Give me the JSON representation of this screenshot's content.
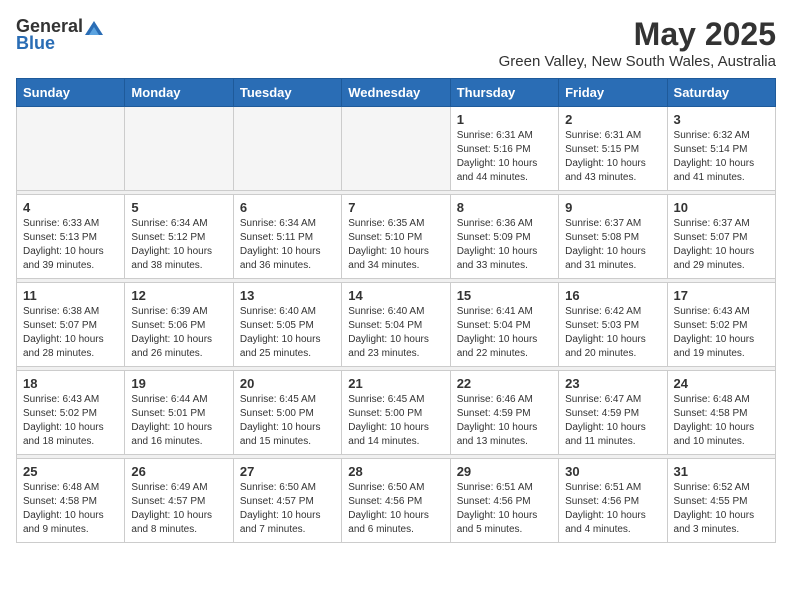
{
  "logo": {
    "general": "General",
    "blue": "Blue"
  },
  "title": {
    "month": "May 2025",
    "location": "Green Valley, New South Wales, Australia"
  },
  "weekdays": [
    "Sunday",
    "Monday",
    "Tuesday",
    "Wednesday",
    "Thursday",
    "Friday",
    "Saturday"
  ],
  "weeks": [
    [
      {
        "day": "",
        "info": ""
      },
      {
        "day": "",
        "info": ""
      },
      {
        "day": "",
        "info": ""
      },
      {
        "day": "",
        "info": ""
      },
      {
        "day": "1",
        "info": "Sunrise: 6:31 AM\nSunset: 5:16 PM\nDaylight: 10 hours\nand 44 minutes."
      },
      {
        "day": "2",
        "info": "Sunrise: 6:31 AM\nSunset: 5:15 PM\nDaylight: 10 hours\nand 43 minutes."
      },
      {
        "day": "3",
        "info": "Sunrise: 6:32 AM\nSunset: 5:14 PM\nDaylight: 10 hours\nand 41 minutes."
      }
    ],
    [
      {
        "day": "4",
        "info": "Sunrise: 6:33 AM\nSunset: 5:13 PM\nDaylight: 10 hours\nand 39 minutes."
      },
      {
        "day": "5",
        "info": "Sunrise: 6:34 AM\nSunset: 5:12 PM\nDaylight: 10 hours\nand 38 minutes."
      },
      {
        "day": "6",
        "info": "Sunrise: 6:34 AM\nSunset: 5:11 PM\nDaylight: 10 hours\nand 36 minutes."
      },
      {
        "day": "7",
        "info": "Sunrise: 6:35 AM\nSunset: 5:10 PM\nDaylight: 10 hours\nand 34 minutes."
      },
      {
        "day": "8",
        "info": "Sunrise: 6:36 AM\nSunset: 5:09 PM\nDaylight: 10 hours\nand 33 minutes."
      },
      {
        "day": "9",
        "info": "Sunrise: 6:37 AM\nSunset: 5:08 PM\nDaylight: 10 hours\nand 31 minutes."
      },
      {
        "day": "10",
        "info": "Sunrise: 6:37 AM\nSunset: 5:07 PM\nDaylight: 10 hours\nand 29 minutes."
      }
    ],
    [
      {
        "day": "11",
        "info": "Sunrise: 6:38 AM\nSunset: 5:07 PM\nDaylight: 10 hours\nand 28 minutes."
      },
      {
        "day": "12",
        "info": "Sunrise: 6:39 AM\nSunset: 5:06 PM\nDaylight: 10 hours\nand 26 minutes."
      },
      {
        "day": "13",
        "info": "Sunrise: 6:40 AM\nSunset: 5:05 PM\nDaylight: 10 hours\nand 25 minutes."
      },
      {
        "day": "14",
        "info": "Sunrise: 6:40 AM\nSunset: 5:04 PM\nDaylight: 10 hours\nand 23 minutes."
      },
      {
        "day": "15",
        "info": "Sunrise: 6:41 AM\nSunset: 5:04 PM\nDaylight: 10 hours\nand 22 minutes."
      },
      {
        "day": "16",
        "info": "Sunrise: 6:42 AM\nSunset: 5:03 PM\nDaylight: 10 hours\nand 20 minutes."
      },
      {
        "day": "17",
        "info": "Sunrise: 6:43 AM\nSunset: 5:02 PM\nDaylight: 10 hours\nand 19 minutes."
      }
    ],
    [
      {
        "day": "18",
        "info": "Sunrise: 6:43 AM\nSunset: 5:02 PM\nDaylight: 10 hours\nand 18 minutes."
      },
      {
        "day": "19",
        "info": "Sunrise: 6:44 AM\nSunset: 5:01 PM\nDaylight: 10 hours\nand 16 minutes."
      },
      {
        "day": "20",
        "info": "Sunrise: 6:45 AM\nSunset: 5:00 PM\nDaylight: 10 hours\nand 15 minutes."
      },
      {
        "day": "21",
        "info": "Sunrise: 6:45 AM\nSunset: 5:00 PM\nDaylight: 10 hours\nand 14 minutes."
      },
      {
        "day": "22",
        "info": "Sunrise: 6:46 AM\nSunset: 4:59 PM\nDaylight: 10 hours\nand 13 minutes."
      },
      {
        "day": "23",
        "info": "Sunrise: 6:47 AM\nSunset: 4:59 PM\nDaylight: 10 hours\nand 11 minutes."
      },
      {
        "day": "24",
        "info": "Sunrise: 6:48 AM\nSunset: 4:58 PM\nDaylight: 10 hours\nand 10 minutes."
      }
    ],
    [
      {
        "day": "25",
        "info": "Sunrise: 6:48 AM\nSunset: 4:58 PM\nDaylight: 10 hours\nand 9 minutes."
      },
      {
        "day": "26",
        "info": "Sunrise: 6:49 AM\nSunset: 4:57 PM\nDaylight: 10 hours\nand 8 minutes."
      },
      {
        "day": "27",
        "info": "Sunrise: 6:50 AM\nSunset: 4:57 PM\nDaylight: 10 hours\nand 7 minutes."
      },
      {
        "day": "28",
        "info": "Sunrise: 6:50 AM\nSunset: 4:56 PM\nDaylight: 10 hours\nand 6 minutes."
      },
      {
        "day": "29",
        "info": "Sunrise: 6:51 AM\nSunset: 4:56 PM\nDaylight: 10 hours\nand 5 minutes."
      },
      {
        "day": "30",
        "info": "Sunrise: 6:51 AM\nSunset: 4:56 PM\nDaylight: 10 hours\nand 4 minutes."
      },
      {
        "day": "31",
        "info": "Sunrise: 6:52 AM\nSunset: 4:55 PM\nDaylight: 10 hours\nand 3 minutes."
      }
    ]
  ]
}
